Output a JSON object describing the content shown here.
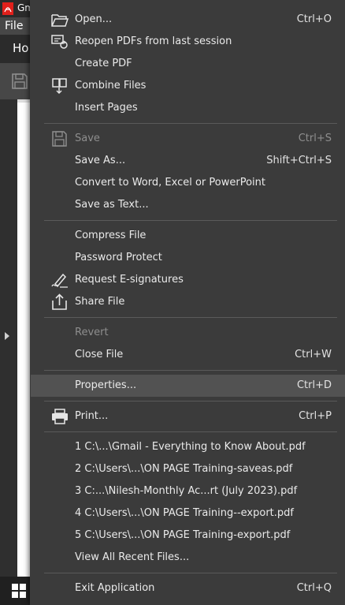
{
  "app": {
    "title": "Gm",
    "file_menu": "File",
    "ribbon_tab": "Ho"
  },
  "menu": {
    "items": [
      {
        "id": "open",
        "label": "Open...",
        "shortcut": "Ctrl+O",
        "icon": "folder-open-icon"
      },
      {
        "id": "reopen",
        "label": "Reopen PDFs from last session",
        "shortcut": "",
        "icon": "reopen-session-icon"
      },
      {
        "id": "create-pdf",
        "label": "Create PDF",
        "shortcut": ""
      },
      {
        "id": "combine",
        "label": "Combine Files",
        "shortcut": "",
        "icon": "combine-files-icon"
      },
      {
        "id": "insert-pages",
        "label": "Insert Pages",
        "shortcut": ""
      },
      {
        "id": "save",
        "label": "Save",
        "shortcut": "Ctrl+S",
        "icon": "save-icon",
        "disabled": true
      },
      {
        "id": "save-as",
        "label": "Save As...",
        "shortcut": "Shift+Ctrl+S"
      },
      {
        "id": "convert",
        "label": "Convert to Word, Excel or PowerPoint",
        "shortcut": ""
      },
      {
        "id": "save-text",
        "label": "Save as Text...",
        "shortcut": ""
      },
      {
        "id": "compress",
        "label": "Compress File",
        "shortcut": ""
      },
      {
        "id": "password",
        "label": "Password Protect",
        "shortcut": ""
      },
      {
        "id": "esign",
        "label": "Request E-signatures",
        "shortcut": "",
        "icon": "pen-signature-icon"
      },
      {
        "id": "share",
        "label": "Share File",
        "shortcut": "",
        "icon": "share-icon"
      },
      {
        "id": "revert",
        "label": "Revert",
        "shortcut": "",
        "disabled": true
      },
      {
        "id": "close",
        "label": "Close File",
        "shortcut": "Ctrl+W"
      },
      {
        "id": "properties",
        "label": "Properties...",
        "shortcut": "Ctrl+D",
        "highlighted": true
      },
      {
        "id": "print",
        "label": "Print...",
        "shortcut": "Ctrl+P",
        "icon": "printer-icon"
      },
      {
        "id": "recent-1",
        "label": "1 C:\\...\\Gmail - Everything to Know About.pdf",
        "shortcut": ""
      },
      {
        "id": "recent-2",
        "label": "2 C:\\Users\\...\\ON PAGE Training-saveas.pdf",
        "shortcut": ""
      },
      {
        "id": "recent-3",
        "label": "3 C:...\\Nilesh-Monthly Ac...rt (July 2023).pdf",
        "shortcut": ""
      },
      {
        "id": "recent-4",
        "label": "4 C:\\Users\\...\\ON PAGE Training--export.pdf",
        "shortcut": ""
      },
      {
        "id": "recent-5",
        "label": "5 C:\\Users\\...\\ON PAGE Training-export.pdf",
        "shortcut": ""
      },
      {
        "id": "view-recent",
        "label": "View All Recent Files...",
        "shortcut": ""
      },
      {
        "id": "exit",
        "label": "Exit Application",
        "shortcut": "Ctrl+Q"
      }
    ]
  },
  "colors": {
    "menu_bg": "#3b3b3b",
    "hover_bg": "#525252",
    "separator": "#5a5a5a",
    "disabled_text": "#8e8e8e",
    "brand_red": "#e0201b"
  }
}
